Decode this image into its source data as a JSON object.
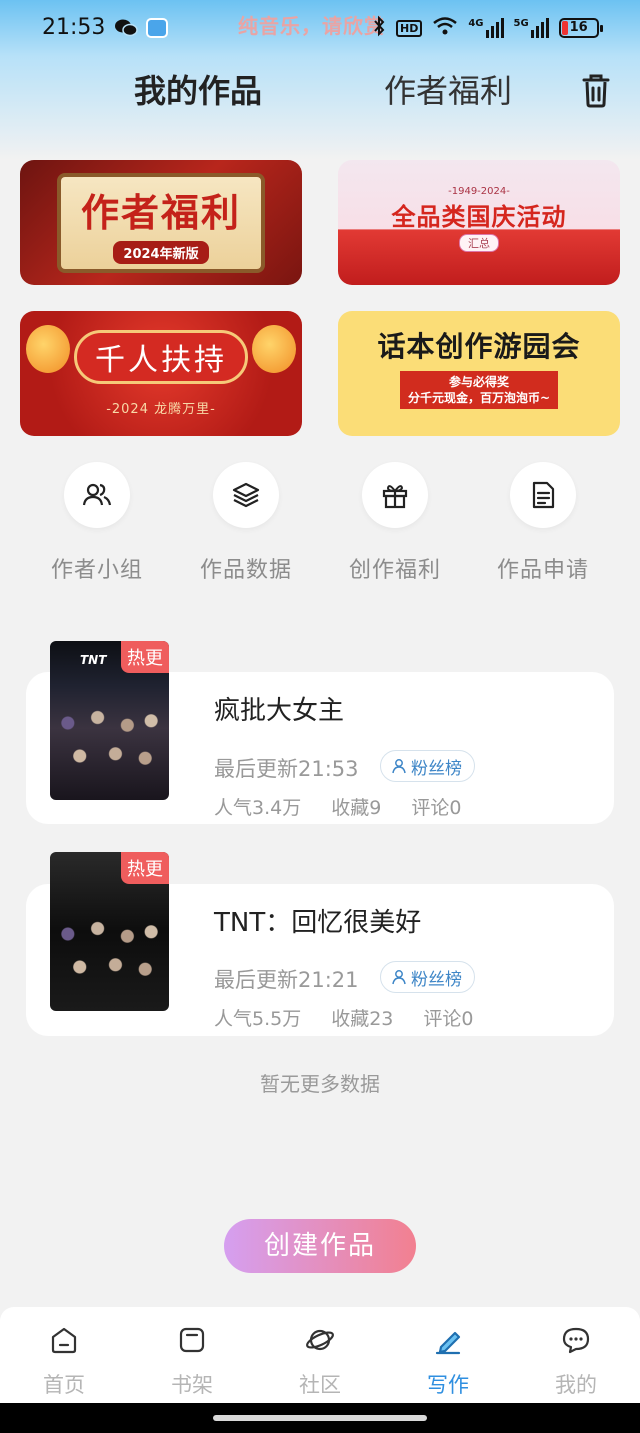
{
  "status_bar": {
    "time": "21:53",
    "notice": "纯音乐，请欣赏",
    "net_1": "HD",
    "net_2": "4G",
    "net_3": "5G",
    "battery": "16"
  },
  "header": {
    "tab_mine": "我的作品",
    "tab_welfare": "作者福利"
  },
  "banners": [
    {
      "title": "作者福利",
      "sub": "2024年新版"
    },
    {
      "top": "-1949-2024-",
      "title": "全品类国庆活动",
      "sub": "汇总"
    },
    {
      "title": "千人扶持",
      "sub": "-2024 龙腾万里-"
    },
    {
      "title": "话本创作游园会",
      "sub_1": "参与必得奖",
      "sub_2": "分千元现金，百万泡泡币~"
    }
  ],
  "quick_actions": [
    {
      "label": "作者小组",
      "icon": "users-icon"
    },
    {
      "label": "作品数据",
      "icon": "layers-icon"
    },
    {
      "label": "创作福利",
      "icon": "gift-icon"
    },
    {
      "label": "作品申请",
      "icon": "document-icon"
    }
  ],
  "works": [
    {
      "badge": "热更",
      "cover_brand": "TNT",
      "title": "疯批大女主",
      "updated": "最后更新21:53",
      "fans_label": "粉丝榜",
      "popularity": "人气3.4万",
      "favorites": "收藏9",
      "comments": "评论0"
    },
    {
      "badge": "热更",
      "title": "TNT：回忆很美好",
      "updated": "最后更新21:21",
      "fans_label": "粉丝榜",
      "popularity": "人气5.5万",
      "favorites": "收藏23",
      "comments": "评论0"
    }
  ],
  "empty_text": "暂无更多数据",
  "create_button": "创建作品",
  "bottom_nav": [
    {
      "label": "首页",
      "icon": "home-icon"
    },
    {
      "label": "书架",
      "icon": "bookshelf-icon"
    },
    {
      "label": "社区",
      "icon": "planet-icon"
    },
    {
      "label": "写作",
      "icon": "pen-icon",
      "active": true
    },
    {
      "label": "我的",
      "icon": "chat-icon"
    }
  ],
  "colors": {
    "accent": "#2f8fe0",
    "hot_badge": "#ef5d5d",
    "create_gradient_start": "#d59ff0",
    "create_gradient_end": "#f28090"
  }
}
